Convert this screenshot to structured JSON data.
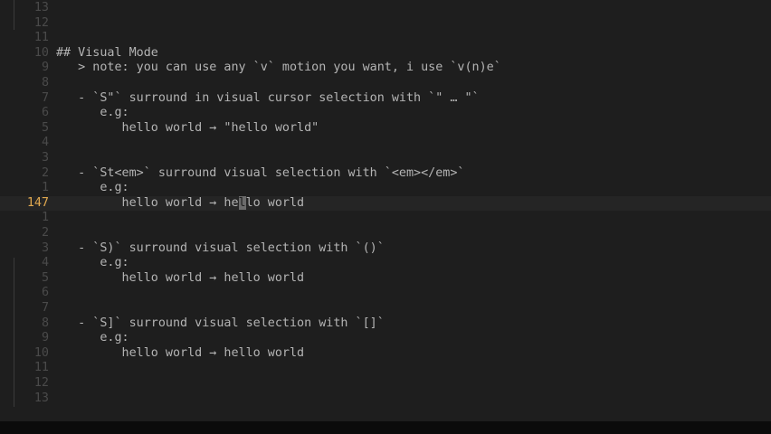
{
  "editor": {
    "cursor_line_index": 13,
    "cursor_column": 25,
    "lines": [
      {
        "num": "13",
        "text": ""
      },
      {
        "num": "12",
        "text": ""
      },
      {
        "num": "11",
        "text": ""
      },
      {
        "num": "10",
        "text": "## Visual Mode"
      },
      {
        "num": "9",
        "text": "   > note: you can use any `v` motion you want, i use `v(n)e`"
      },
      {
        "num": "8",
        "text": ""
      },
      {
        "num": "7",
        "text": "   - `S\"` surround in visual cursor selection with `\" … \"`"
      },
      {
        "num": "6",
        "text": "      e.g:"
      },
      {
        "num": "5",
        "text": "         hello world → \"hello world\""
      },
      {
        "num": "4",
        "text": ""
      },
      {
        "num": "3",
        "text": ""
      },
      {
        "num": "2",
        "text": "   - `St<em>` surround visual selection with `<em></em>`"
      },
      {
        "num": "1",
        "text": "      e.g:"
      },
      {
        "num": "147",
        "text": "         hello world → hello world"
      },
      {
        "num": "1",
        "text": ""
      },
      {
        "num": "2",
        "text": ""
      },
      {
        "num": "3",
        "text": "   - `S)` surround visual selection with `()`"
      },
      {
        "num": "4",
        "text": "      e.g:"
      },
      {
        "num": "5",
        "text": "         hello world → hello world"
      },
      {
        "num": "6",
        "text": ""
      },
      {
        "num": "7",
        "text": ""
      },
      {
        "num": "8",
        "text": "   - `S]` surround visual selection with `[]`"
      },
      {
        "num": "9",
        "text": "      e.g:"
      },
      {
        "num": "10",
        "text": "         hello world → hello world"
      },
      {
        "num": "11",
        "text": ""
      },
      {
        "num": "12",
        "text": ""
      },
      {
        "num": "13",
        "text": ""
      }
    ]
  }
}
